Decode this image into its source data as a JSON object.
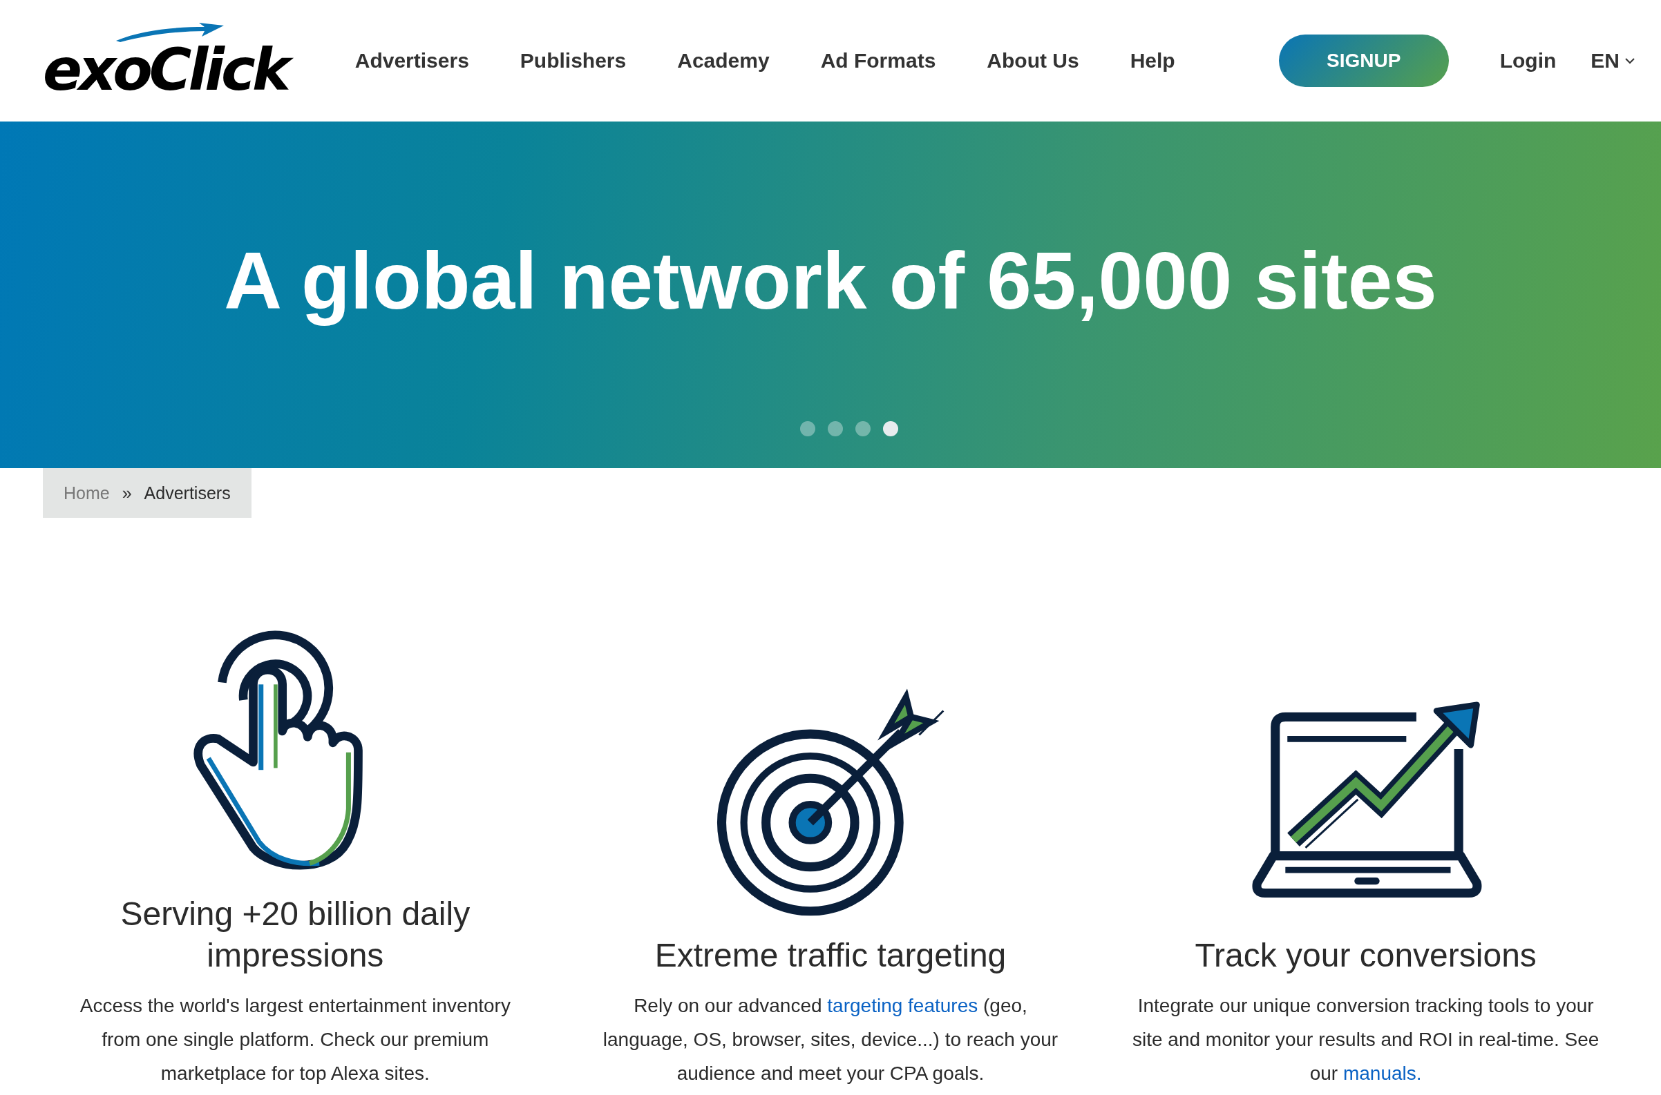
{
  "header": {
    "logo": "exoClick",
    "nav": [
      "Advertisers",
      "Publishers",
      "Academy",
      "Ad Formats",
      "About Us",
      "Help"
    ],
    "signup": "SIGNUP",
    "login": "Login",
    "language": "EN"
  },
  "hero": {
    "title": "A global network of 65,000 sites",
    "slides": [
      {
        "selected": false
      },
      {
        "selected": false
      },
      {
        "selected": false
      },
      {
        "selected": true
      }
    ]
  },
  "breadcrumb": [
    {
      "label": "Home",
      "current": false
    },
    {
      "label": "Advertisers",
      "current": true
    }
  ],
  "breadcrumb_separator": "»",
  "features": [
    {
      "kind": "hand",
      "title": "Serving +20 billion daily impressions",
      "text": [
        {
          "text": "Access the world's largest entertainment inventory from one single platform. Check our premium marketplace for top Alexa sites.",
          "link": false
        }
      ]
    },
    {
      "kind": "target",
      "title": "Extreme traffic targeting",
      "text": [
        {
          "text": "Rely on our advanced ",
          "link": false
        },
        {
          "text": "targeting features",
          "link": true
        },
        {
          "text": " (geo, language, OS, browser, sites, device...) to reach your audience and meet your CPA goals.",
          "link": false
        }
      ]
    },
    {
      "kind": "laptop",
      "title": "Track your conversions",
      "text": [
        {
          "text": "Integrate our unique conversion tracking tools to your site and monitor your results and ROI in real-time. See our ",
          "link": false
        },
        {
          "text": "manuals.",
          "link": true
        }
      ]
    }
  ]
}
